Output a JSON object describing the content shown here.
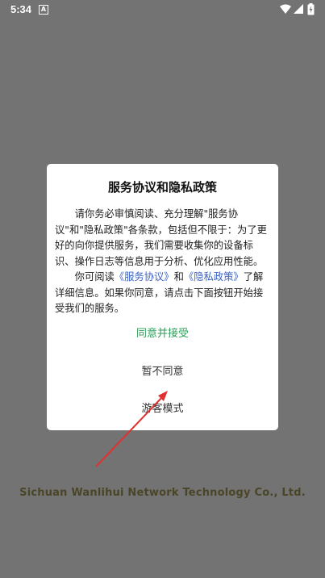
{
  "status_bar": {
    "time": "5:34",
    "notification_glyph": "A",
    "icons": [
      "wifi-icon",
      "signal-icon",
      "battery-icon"
    ],
    "text_color": "#ffffff"
  },
  "background": {
    "company": "Sichuan Wanlihui Network Technology Co., Ltd.",
    "overlay_color": "#737373"
  },
  "dialog": {
    "title": "服务协议和隐私政策",
    "para1": "请你务必审慎阅读、充分理解\"服务协议\"和\"隐私政策\"各条款，包括但不限于：为了更好的向你提供服务，我们需要收集你的设备标识、操作日志等信息用于分析、优化应用性能。",
    "para2_prefix": "你可阅读",
    "service_link": "《服务协议》",
    "para2_and": "和",
    "privacy_link": "《隐私政策》",
    "para2_suffix": "了解详细信息。如果你同意，请点击下面按钮开始接受我们的服务。",
    "agree_label": "同意并接受",
    "disagree_label": "暂不同意",
    "guest_label": "游客模式",
    "colors": {
      "agree": "#2e9e5a",
      "link": "#3b62c4",
      "annotation_arrow": "#e03030"
    }
  }
}
